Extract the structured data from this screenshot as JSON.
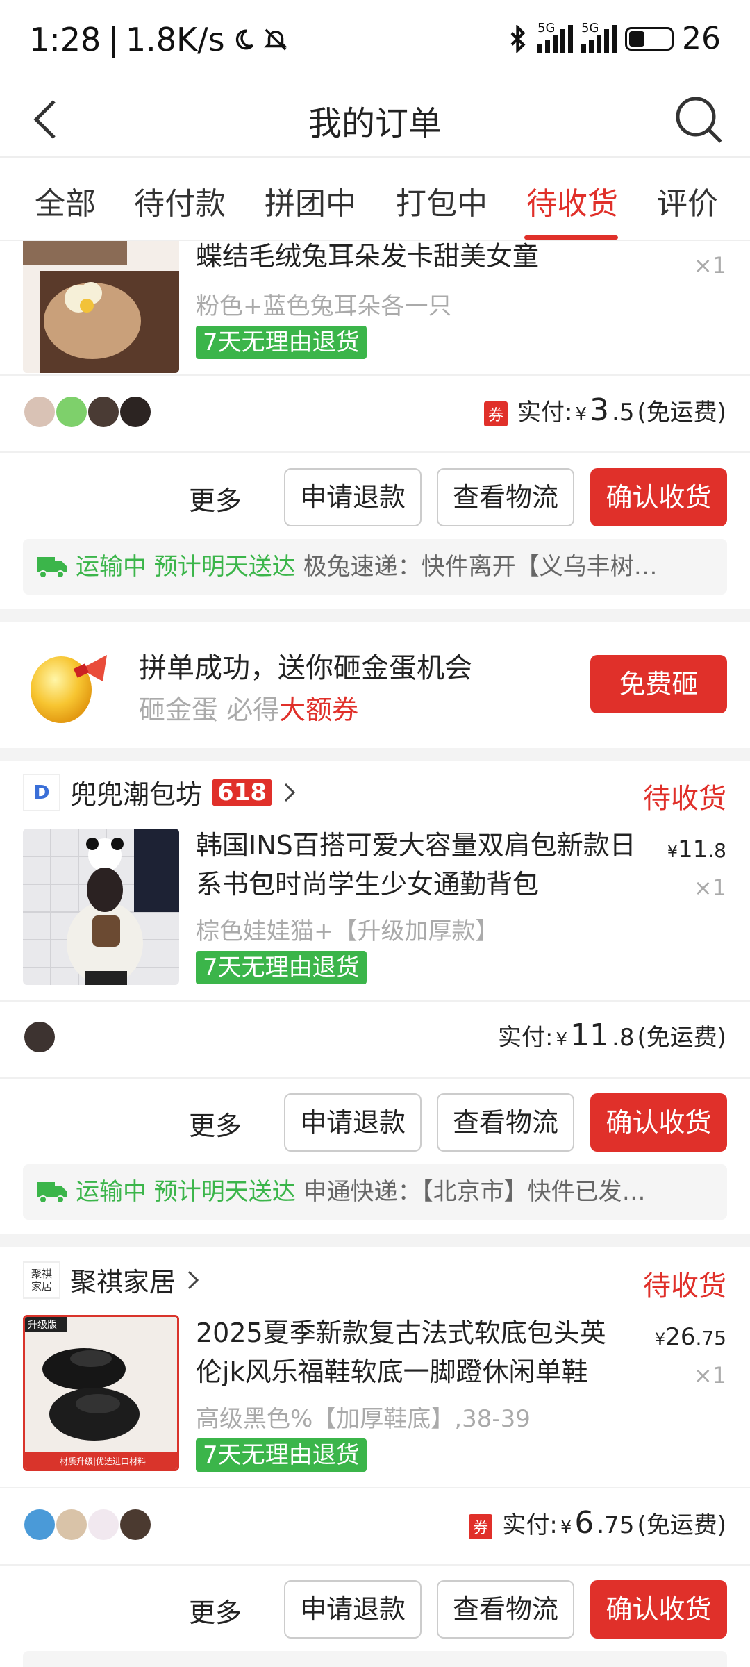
{
  "status_bar": {
    "time": "1:28",
    "net": "1.8K/s",
    "signal1": "5G",
    "signal2": "5G",
    "battery": "26"
  },
  "nav": {
    "title": "我的订单"
  },
  "tabs": [
    {
      "label": "全部"
    },
    {
      "label": "待付款"
    },
    {
      "label": "拼团中"
    },
    {
      "label": "打包中"
    },
    {
      "label": "待收货",
      "active": true
    },
    {
      "label": "评价"
    }
  ],
  "order1": {
    "title": "蝶结毛绒兔耳朵发卡甜美女童",
    "spec": "粉色+蓝色兔耳朵各一只",
    "badge": "7天无理由退货",
    "qty": "×1",
    "paid_label": "实付:",
    "coupon": "券",
    "yen": "¥",
    "paid_int": "3",
    "paid_dec": ".5",
    "free_ship": "(免运费)",
    "more": "更多",
    "refund": "申请退款",
    "logistics": "查看物流",
    "confirm": "确认收货",
    "ship_status": "运输中 预计明天送达",
    "ship_detail": "极兔速递：快件离开【义乌丰树…"
  },
  "promo": {
    "title": "拼单成功，送你砸金蛋机会",
    "sub_gray": "砸金蛋 必得",
    "sub_red": "大额券",
    "button": "免费砸"
  },
  "order2": {
    "shop": "兜兜潮包坊",
    "shop_badge": "618",
    "shop_logo": "D",
    "status": "待收货",
    "title": "韩国INS百搭可爱大容量双肩包新款日系书包时尚学生少女通勤背包",
    "yen": "¥",
    "price_int": "11",
    "price_dec": ".8",
    "qty": "×1",
    "spec": "棕色娃娃猫+【升级加厚款】",
    "badge": "7天无理由退货",
    "paid_label": "实付:",
    "paid_int": "11",
    "paid_dec": ".8",
    "free_ship": "(免运费)",
    "more": "更多",
    "refund": "申请退款",
    "logistics": "查看物流",
    "confirm": "确认收货",
    "ship_status": "运输中 预计明天送达",
    "ship_detail": "申通快递：【北京市】快件已发…"
  },
  "order3": {
    "shop": "聚祺家居",
    "shop_logo": "聚祺家居",
    "status": "待收货",
    "title": "2025夏季新款复古法式软底包头英伦jk风乐福鞋软底一脚蹬休闲单鞋",
    "yen": "¥",
    "price_int": "26",
    "price_dec": ".75",
    "qty": "×1",
    "spec": "高级黑色%【加厚鞋底】,38-39",
    "badge": "7天无理由退货",
    "img_tag": "升级版",
    "img_caption": "材质升级|优选进口材料",
    "coupon": "券",
    "paid_label": "实付:",
    "paid_int": "6",
    "paid_dec": ".75",
    "free_ship": "(免运费)",
    "more": "更多",
    "refund": "申请退款",
    "logistics": "查看物流",
    "confirm": "确认收货"
  }
}
